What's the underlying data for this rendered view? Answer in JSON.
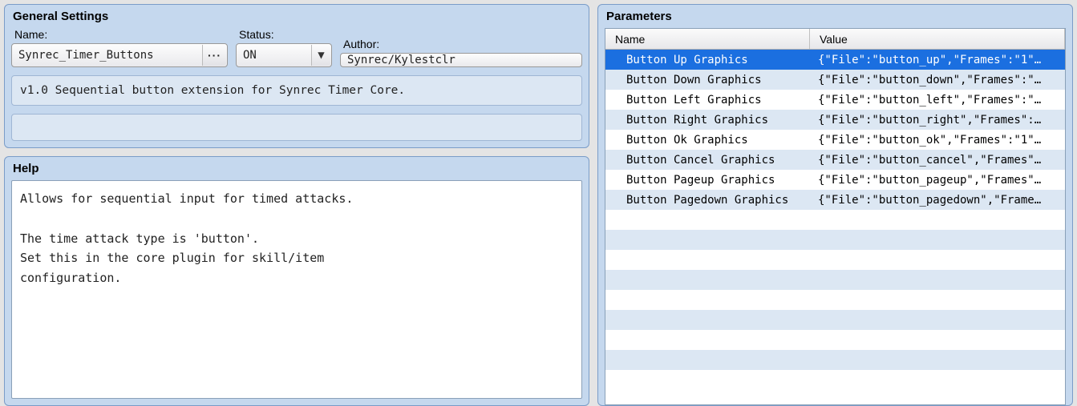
{
  "general": {
    "title": "General Settings",
    "name_label": "Name:",
    "name_value": "Synrec_Timer_Buttons",
    "status_label": "Status:",
    "status_value": "ON",
    "author_label": "Author:",
    "author_value": "Synrec/Kylestclr",
    "description": "v1.0 Sequential button extension for Synrec Timer Core."
  },
  "help": {
    "title": "Help",
    "body": "Allows for sequential input for timed attacks.\n\nThe time attack type is 'button'.\nSet this in the core plugin for skill/item\nconfiguration."
  },
  "parameters": {
    "title": "Parameters",
    "columns": {
      "name": "Name",
      "value": "Value"
    },
    "rows": [
      {
        "name": "Button Up Graphics",
        "value": "{\"File\":\"button_up\",\"Frames\":\"1\"…",
        "selected": true
      },
      {
        "name": "Button Down Graphics",
        "value": "{\"File\":\"button_down\",\"Frames\":\"…"
      },
      {
        "name": "Button Left Graphics",
        "value": "{\"File\":\"button_left\",\"Frames\":\"…"
      },
      {
        "name": "Button Right Graphics",
        "value": "{\"File\":\"button_right\",\"Frames\":…"
      },
      {
        "name": "Button Ok Graphics",
        "value": "{\"File\":\"button_ok\",\"Frames\":\"1\"…"
      },
      {
        "name": "Button Cancel Graphics",
        "value": "{\"File\":\"button_cancel\",\"Frames\"…"
      },
      {
        "name": "Button Pageup Graphics",
        "value": "{\"File\":\"button_pageup\",\"Frames\"…"
      },
      {
        "name": "Button Pagedown Graphics",
        "value": "{\"File\":\"button_pagedown\",\"Frame…"
      }
    ],
    "empty_rows": 9
  }
}
